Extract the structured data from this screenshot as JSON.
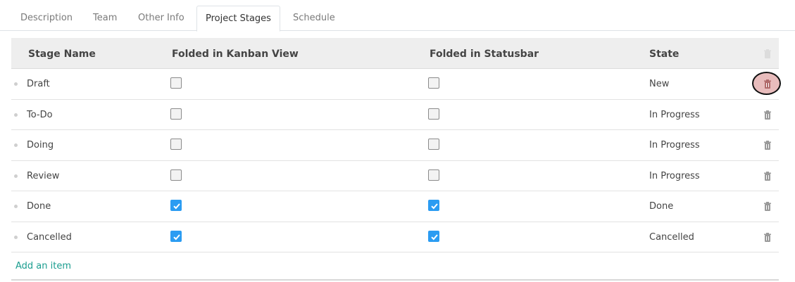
{
  "tabs": [
    {
      "label": "Description"
    },
    {
      "label": "Team"
    },
    {
      "label": "Other Info"
    },
    {
      "label": "Project Stages"
    },
    {
      "label": "Schedule"
    }
  ],
  "table": {
    "headers": {
      "name": "Stage Name",
      "kanban": "Folded in Kanban View",
      "statusbar": "Folded in Statusbar",
      "state": "State"
    },
    "rows": [
      {
        "name": "Draft",
        "kanban": false,
        "statusbar": false,
        "state": "New"
      },
      {
        "name": "To-Do",
        "kanban": false,
        "statusbar": false,
        "state": "In Progress"
      },
      {
        "name": "Doing",
        "kanban": false,
        "statusbar": false,
        "state": "In Progress"
      },
      {
        "name": "Review",
        "kanban": false,
        "statusbar": false,
        "state": "In Progress"
      },
      {
        "name": "Done",
        "kanban": true,
        "statusbar": true,
        "state": "Done"
      },
      {
        "name": "Cancelled",
        "kanban": true,
        "statusbar": true,
        "state": "Cancelled"
      }
    ],
    "add_item_label": "Add an item"
  },
  "colors": {
    "accent": "#1a9d8f",
    "checkbox_checked": "#2b9cf2"
  }
}
